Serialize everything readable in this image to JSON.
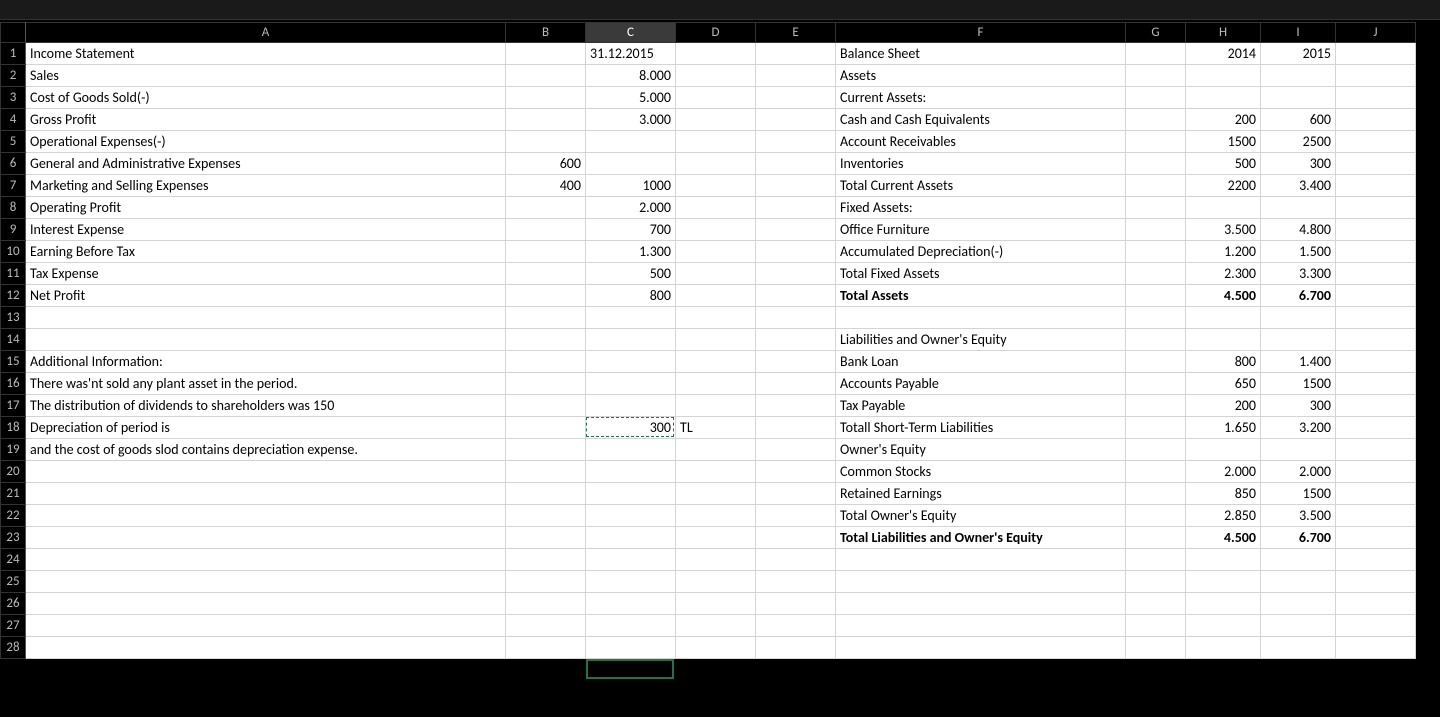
{
  "columns": [
    "A",
    "B",
    "C",
    "D",
    "E",
    "F",
    "G",
    "H",
    "I",
    "J"
  ],
  "selected_col": "C",
  "row_count": 28,
  "cells": {
    "r1": {
      "A": "Income Statement",
      "C": "31.12.2015",
      "F": "Balance Sheet",
      "H": "2014",
      "I": "2015"
    },
    "r2": {
      "A": "Sales",
      "C": "8.000",
      "F": "Assets"
    },
    "r3": {
      "A": "Cost of Goods Sold(-)",
      "C": "5.000",
      "F": "Current Assets:"
    },
    "r4": {
      "A": "Gross Profit",
      "C": "3.000",
      "F": "Cash and Cash Equivalents",
      "H": "200",
      "I": "600"
    },
    "r5": {
      "A": "Operational Expenses(-)",
      "F": "Account Receivables",
      "H": "1500",
      "I": "2500"
    },
    "r6": {
      "A": "General and Administrative Expenses",
      "B": "600",
      "F": "Inventories",
      "H": "500",
      "I": "300"
    },
    "r7": {
      "A": "Marketing and Selling Expenses",
      "B": "400",
      "C": "1000",
      "F": "Total Current Assets",
      "H": "2200",
      "I": "3.400"
    },
    "r8": {
      "A": "Operating Profit",
      "C": "2.000",
      "F": "Fixed Assets:"
    },
    "r9": {
      "A": "Interest Expense",
      "C": "700",
      "F": "Office Furniture",
      "H": "3.500",
      "I": "4.800"
    },
    "r10": {
      "A": "Earning Before Tax",
      "C": "1.300",
      "F": "Accumulated Depreciation(-)",
      "H": "1.200",
      "I": "1.500"
    },
    "r11": {
      "A": "Tax Expense",
      "C": "500",
      "F": "Total Fixed Assets",
      "H": "2.300",
      "I": "3.300"
    },
    "r12": {
      "A": "Net Profit",
      "C": "800",
      "F": "Total Assets",
      "H": "4.500",
      "I": "6.700",
      "bold": [
        "F",
        "H",
        "I"
      ]
    },
    "r13": {},
    "r14": {
      "F": "Liabilities and Owner's Equity"
    },
    "r15": {
      "A": "Additional Information:",
      "F": "Bank Loan",
      "H": "800",
      "I": "1.400"
    },
    "r16": {
      "A": "There was'nt sold  any plant asset in the period.",
      "F": "Accounts Payable",
      "H": "650",
      "I": "1500"
    },
    "r17": {
      "A": "The distribution of dividends to shareholders was 150",
      "F": "Tax Payable",
      "H": "200",
      "I": "300"
    },
    "r18": {
      "A": "Depreciation of period is",
      "C": "300",
      "D": "TL",
      "F": "Totall Short-Term Liabilities",
      "H": "1.650",
      "I": "3.200"
    },
    "r19": {
      "A": "and the cost of goods slod contains depreciation expense.",
      "F": "Owner's Equity"
    },
    "r20": {
      "F": "Common Stocks",
      "H": "2.000",
      "I": "2.000"
    },
    "r21": {
      "F": "Retained Earnings",
      "H": "850",
      "I": "1500"
    },
    "r22": {
      "F": "Total Owner's Equity",
      "H": "2.850",
      "I": "3.500"
    },
    "r23": {
      "F": "Total Liabilities and Owner's Equity",
      "H": "4.500",
      "I": "6.700",
      "bold": [
        "F",
        "H",
        "I"
      ]
    },
    "r24": {},
    "r25": {},
    "r26": {},
    "r27": {},
    "r28": {}
  },
  "alignment": {
    "left_cols": [
      "A",
      "D",
      "F"
    ],
    "right_cols": [
      "B",
      "C",
      "H",
      "I"
    ]
  },
  "header_right_cells": [
    "H1",
    "I1"
  ],
  "header_left_cells": [
    "C1"
  ],
  "copied_cell": "C18",
  "active_cell": "C29"
}
